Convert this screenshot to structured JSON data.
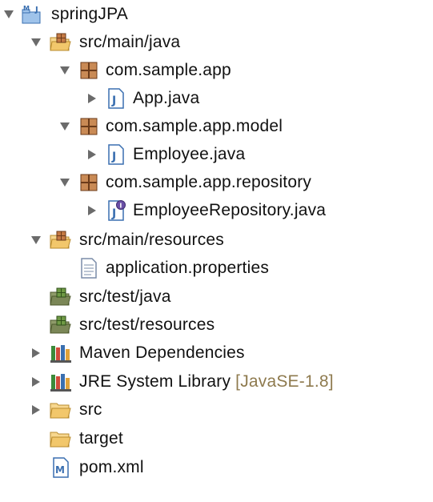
{
  "tree": {
    "project": {
      "label": "springJPA",
      "icon": "maven-java-project-icon",
      "expanded": true
    },
    "src_main_java": {
      "label": "src/main/java",
      "icon": "source-folder-icon",
      "expanded": true,
      "packages": [
        {
          "label": "com.sample.app",
          "icon": "package-icon",
          "expanded": true,
          "file": {
            "label": "App.java",
            "icon": "java-file-icon",
            "expanded": false
          }
        },
        {
          "label": "com.sample.app.model",
          "icon": "package-icon",
          "expanded": true,
          "file": {
            "label": "Employee.java",
            "icon": "java-file-icon",
            "expanded": false
          }
        },
        {
          "label": "com.sample.app.repository",
          "icon": "package-icon",
          "expanded": true,
          "file": {
            "label": "EmployeeRepository.java",
            "icon": "java-interface-file-icon",
            "expanded": false
          }
        }
      ]
    },
    "src_main_resources": {
      "label": "src/main/resources",
      "icon": "source-folder-icon",
      "expanded": true,
      "file": {
        "label": "application.properties",
        "icon": "properties-file-icon"
      }
    },
    "src_test_java": {
      "label": "src/test/java",
      "icon": "test-source-folder-icon"
    },
    "src_test_resources": {
      "label": "src/test/resources",
      "icon": "test-source-folder-icon"
    },
    "maven_dependencies": {
      "label": "Maven Dependencies",
      "icon": "library-icon",
      "expanded": false
    },
    "jre_library": {
      "label": "JRE System Library",
      "decoration": "[JavaSE-1.8]",
      "icon": "library-icon",
      "expanded": false
    },
    "src": {
      "label": "src",
      "icon": "folder-icon",
      "expanded": false
    },
    "target": {
      "label": "target",
      "icon": "folder-icon"
    },
    "pom": {
      "label": "pom.xml",
      "icon": "maven-pom-file-icon"
    }
  },
  "colors": {
    "text": "#111111",
    "decoration": "#8e7a4e",
    "toggle": "#6b6b6b",
    "folder": "#f2c76b",
    "package": "#a0643c",
    "java_blue": "#3a6fb0",
    "library_green": "#3c8a3a"
  }
}
